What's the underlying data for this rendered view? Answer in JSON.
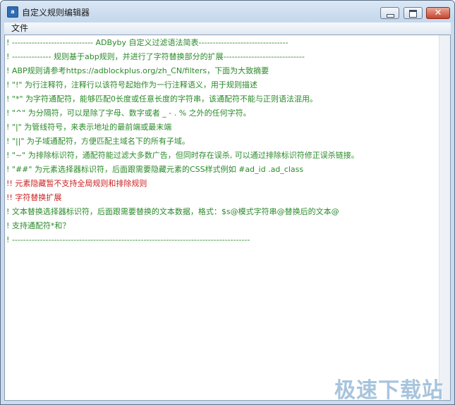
{
  "window": {
    "title": "自定义规则编辑器",
    "icon": "adbyby-app-icon",
    "icon_text": "a"
  },
  "menu": {
    "file_label": "文件"
  },
  "editor": {
    "lines": [
      {
        "text": "!  ----------------------------- ADByby 自定义过滤语法简表--------------------------------",
        "color": "green"
      },
      {
        "text": "!  --------------  规则基于abp规则，并进行了字符替换部分的扩展-----------------------------",
        "color": "green"
      },
      {
        "text": "!  ABP规则请参考https://adblockplus.org/zh_CN/filters，下面为大致摘要",
        "color": "green"
      },
      {
        "text": "!  \"!\" 为行注释符，注释行以该符号起始作为一行注释语义，用于规则描述",
        "color": "green"
      },
      {
        "text": "!  \"*\" 为字符通配符，能够匹配0长度或任意长度的字符串，该通配符不能与正则语法混用。",
        "color": "green"
      },
      {
        "text": "!  \"^\" 为分隔符，可以是除了字母、数字或者 _ - . % 之外的任何字符。",
        "color": "green"
      },
      {
        "text": "!  \"|\" 为管线符号，来表示地址的最前端或最末端",
        "color": "green"
      },
      {
        "text": "!  \"||\" 为子域通配符，方便匹配主域名下的所有子域。",
        "color": "green"
      },
      {
        "text": "!  \"~\" 为排除标识符，通配符能过滤大多数广告，但同时存在误杀, 可以通过排除标识符修正误杀链接。",
        "color": "green"
      },
      {
        "text": "!  \"##\" 为元素选择器标识符，后面跟需要隐藏元素的CSS样式例如 #ad_id  .ad_class",
        "color": "green"
      },
      {
        "text": "!!  元素隐藏暂不支持全局规则和排除规则",
        "color": "red"
      },
      {
        "text": "!!  字符替换扩展",
        "color": "red"
      },
      {
        "text": "!  文本替换选择器标识符，后面跟需要替换的文本数据，格式：$s@模式字符串@替换后的文本@",
        "color": "green"
      },
      {
        "text": "!  支持通配符*和？",
        "color": "green"
      },
      {
        "text": "!  -------------------------------------------------------------------------------------",
        "color": "green"
      }
    ]
  },
  "watermark": {
    "text": "极速下载站"
  },
  "colors": {
    "comment_green": "#2a8a2a",
    "note_red": "#cc1f1f",
    "title_bar": "#c9dbee",
    "close_button": "#c7452b"
  }
}
